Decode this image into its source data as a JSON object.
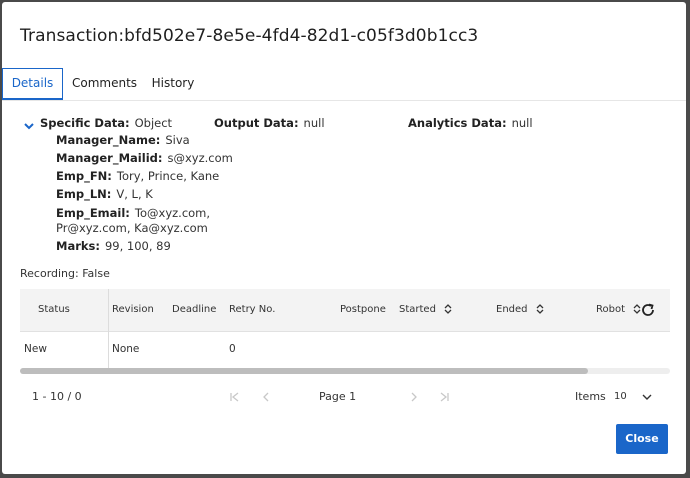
{
  "dialog": {
    "title": "Transaction:bfd502e7-8e5e-4fd4-82d1-c05f3d0b1cc3",
    "close_label": "Close"
  },
  "tabs": [
    {
      "label": "Details",
      "active": true
    },
    {
      "label": "Comments",
      "active": false
    },
    {
      "label": "History",
      "active": false
    }
  ],
  "details": {
    "specific": {
      "key": "Specific Data:",
      "value": "Object"
    },
    "output": {
      "key": "Output Data:",
      "value": "null"
    },
    "analytics": {
      "key": "Analytics Data:",
      "value": "null"
    },
    "fields": [
      {
        "key": "Manager_Name:",
        "value": "Siva"
      },
      {
        "key": "Manager_Mailid:",
        "value": "s@xyz.com"
      },
      {
        "key": "Emp_FN:",
        "value": "Tory, Prince, Kane"
      },
      {
        "key": "Emp_LN:",
        "value": "V, L, K"
      },
      {
        "key": "Emp_Email:",
        "value": "To@xyz.com,",
        "value2": "Pr@xyz.com, Ka@xyz.com"
      },
      {
        "key": "Marks:",
        "value": "99, 100, 89"
      }
    ],
    "recording": "Recording: False"
  },
  "table": {
    "columns": [
      "Status",
      "Revision",
      "Deadline",
      "Retry No.",
      "Postpone",
      "Started",
      "Ended",
      "Robot"
    ],
    "rows": [
      {
        "status": "New",
        "revision": "None",
        "retry": "0"
      }
    ]
  },
  "pager": {
    "range": "1 - 10 / 0",
    "page": "Page 1",
    "items_label": "Items",
    "items_value": "10"
  },
  "colors": {
    "accent": "#1a66c9"
  }
}
